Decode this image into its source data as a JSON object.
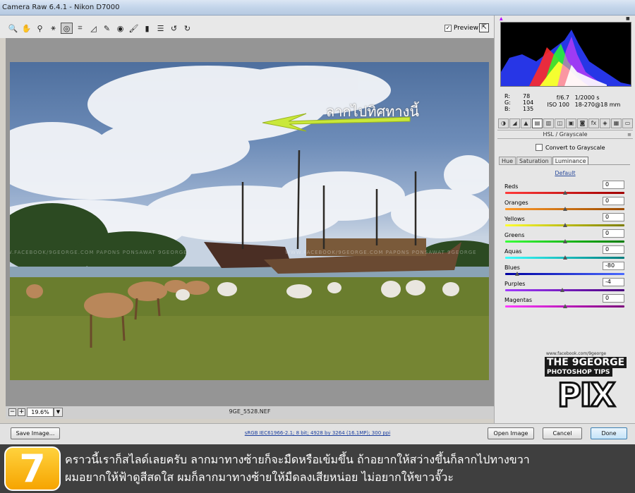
{
  "window": {
    "title": "Camera Raw 6.4.1  -  Nikon D7000"
  },
  "toolbar": {
    "tools": [
      {
        "name": "zoom-tool-icon",
        "glyph": "🔍"
      },
      {
        "name": "hand-tool-icon",
        "glyph": "✋"
      },
      {
        "name": "white-balance-tool-icon",
        "glyph": "⚲"
      },
      {
        "name": "color-sampler-tool-icon",
        "glyph": "⚹"
      },
      {
        "name": "targeted-adjustment-tool-icon",
        "glyph": "◎"
      },
      {
        "name": "crop-tool-icon",
        "glyph": "⌗"
      },
      {
        "name": "straighten-tool-icon",
        "glyph": "◿"
      },
      {
        "name": "spot-removal-tool-icon",
        "glyph": "✎"
      },
      {
        "name": "red-eye-tool-icon",
        "glyph": "◉"
      },
      {
        "name": "adjustment-brush-icon",
        "glyph": "🖌"
      },
      {
        "name": "graduated-filter-icon",
        "glyph": "▮"
      },
      {
        "name": "preferences-icon",
        "glyph": "☰"
      },
      {
        "name": "rotate-left-icon",
        "glyph": "↺"
      },
      {
        "name": "rotate-right-icon",
        "glyph": "↻"
      }
    ],
    "preview_label": "Preview",
    "preview_checked": "✓",
    "fullscreen_glyph": "⇱"
  },
  "image": {
    "annotation_text": "ลากไปทิศทางนี้",
    "watermark_text": "WWW.FACEBOOK/9GEORGE.COM   PAPONS PONSAWAT 9GEORGE"
  },
  "statusbar": {
    "zoom_out": "−",
    "zoom_in": "+",
    "zoom_value": "19.6%",
    "zoom_dropdown": "▼",
    "filename": "9GE_5528.NEF"
  },
  "histogram": {
    "clip_shadow": "▲",
    "clip_highlight": "■"
  },
  "readout": {
    "r_label": "R:",
    "r_value": "78",
    "g_label": "G:",
    "g_value": "104",
    "b_label": "B:",
    "b_value": "135",
    "aperture": "f/6.7",
    "shutter": "1/2000 s",
    "iso": "ISO 100",
    "lens": "18-270@18 mm"
  },
  "panel_tabs": [
    {
      "name": "basic-tab-icon",
      "glyph": "◑"
    },
    {
      "name": "tone-curve-tab-icon",
      "glyph": "◢"
    },
    {
      "name": "detail-tab-icon",
      "glyph": "▲"
    },
    {
      "name": "hsl-tab-icon",
      "glyph": "▤"
    },
    {
      "name": "split-toning-tab-icon",
      "glyph": "▥"
    },
    {
      "name": "lens-corrections-tab-icon",
      "glyph": "◫"
    },
    {
      "name": "effects-tab-icon",
      "glyph": "▣"
    },
    {
      "name": "camera-calibration-tab-icon",
      "glyph": "◙"
    },
    {
      "name": "fx-tab-icon",
      "glyph": "fx"
    },
    {
      "name": "presets-tab-icon",
      "glyph": "◈"
    },
    {
      "name": "settings-tab-icon",
      "glyph": "▦"
    },
    {
      "name": "snapshots-tab-icon",
      "glyph": "▭"
    }
  ],
  "hsl": {
    "title": "HSL / Grayscale",
    "menu_glyph": "≡",
    "convert_label": "Convert to Grayscale",
    "subtabs": [
      "Hue",
      "Saturation",
      "Luminance"
    ],
    "default_link": "Default",
    "sliders": [
      {
        "label": "Reds",
        "value": "0",
        "level": 0,
        "colors": [
          "#ff3a3a",
          "#a00000"
        ]
      },
      {
        "label": "Oranges",
        "value": "0",
        "level": 0,
        "colors": [
          "#ff9a2a",
          "#9a4a00"
        ]
      },
      {
        "label": "Yellows",
        "value": "0",
        "level": 0,
        "colors": [
          "#ffff30",
          "#7c7c00"
        ]
      },
      {
        "label": "Greens",
        "value": "0",
        "level": 0,
        "colors": [
          "#3aff3a",
          "#007c00"
        ]
      },
      {
        "label": "Aquas",
        "value": "0",
        "level": 0,
        "colors": [
          "#3affff",
          "#007c7c"
        ]
      },
      {
        "label": "Blues",
        "value": "-80",
        "level": -80,
        "colors": [
          "#0000a0",
          "#4a6aff"
        ]
      },
      {
        "label": "Purples",
        "value": "-4",
        "level": -4,
        "colors": [
          "#a03aff",
          "#4a007c"
        ]
      },
      {
        "label": "Magentas",
        "value": "0",
        "level": 0,
        "colors": [
          "#ff3aff",
          "#7c007c"
        ]
      }
    ]
  },
  "buttons": {
    "save": "Save Image...",
    "workflow": "sRGB IEC61966-2.1; 8 bit; 4928 by 3264 (16.1MP); 300 ppi",
    "open": "Open Image",
    "cancel": "Cancel",
    "done": "Done"
  },
  "caption": {
    "step": "7",
    "line1": "คราวนี้เราก็สไลด์เลยครับ ลากมาทางซ้ายก็จะมืดหรือเข้มขึ้น ถ้าอยากให้สว่างขึ้นก็ลากไปทางขวา",
    "line2": "ผมอยากให้ฟ้าดูสีสดใส ผมก็ลากมาทางซ้ายให้มืดลงเสียหน่อย ไม่อยากให้ขาวจั๊วะ"
  },
  "logo": {
    "url": "www.facebook.com/9george",
    "line1": "THE 9GEORGE",
    "line2": "PHOTOSHOP TIPS",
    "line3": "PIX"
  }
}
